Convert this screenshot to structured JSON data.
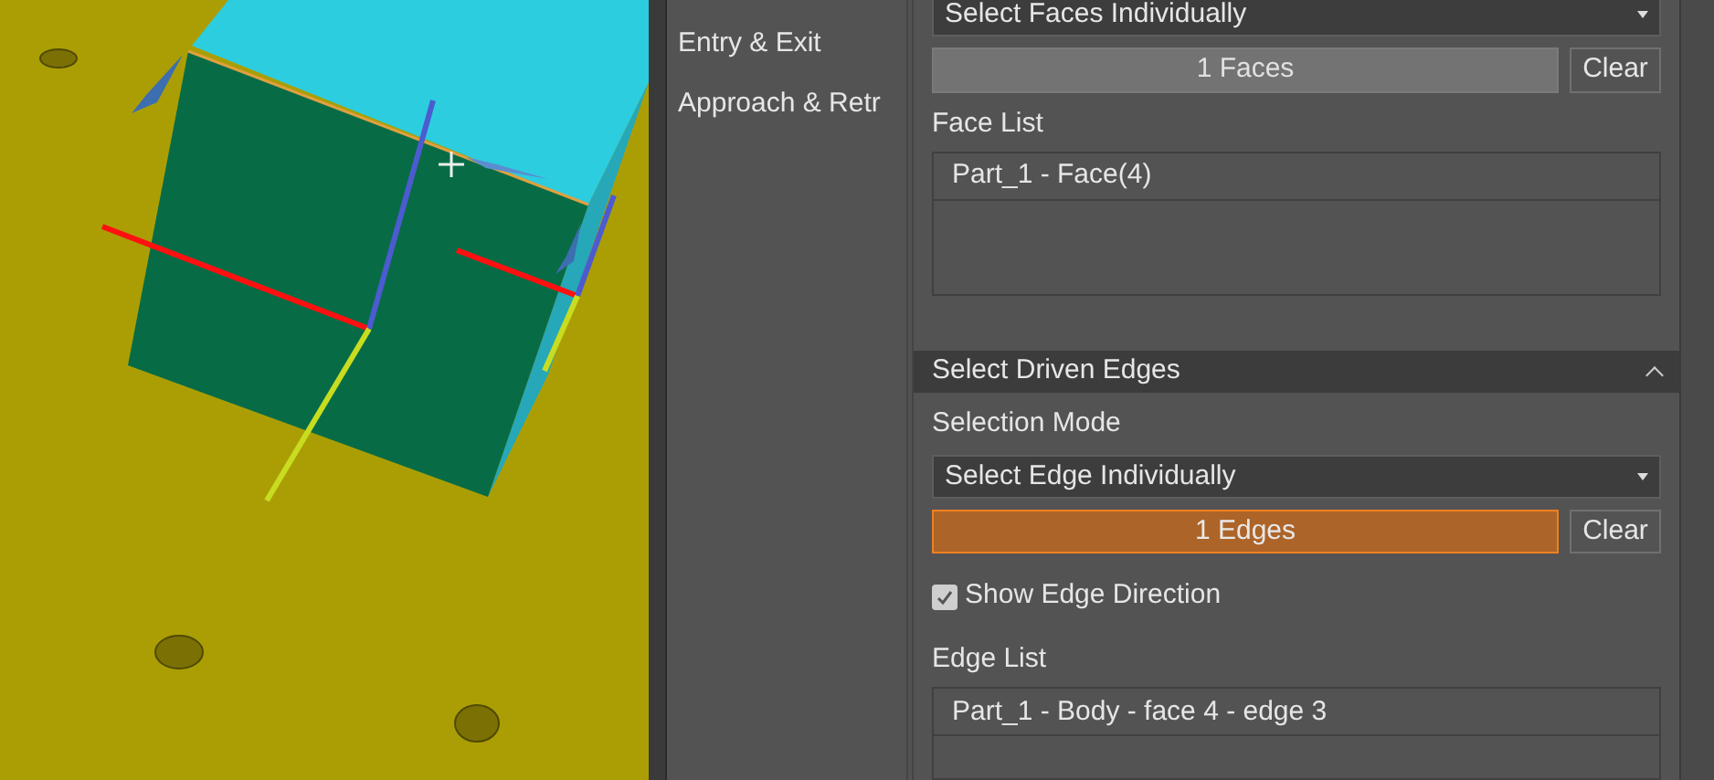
{
  "nav_items": [
    {
      "label": "Entry & Exit"
    },
    {
      "label": "Approach & Retr"
    }
  ],
  "face_selection": {
    "mode_dropdown": {
      "value": "Select Faces Individually"
    },
    "count_button": {
      "label": "1 Faces",
      "active": false
    },
    "clear_button": "Clear",
    "list_label": "Face List",
    "list_items": [
      "Part_1 - Face(4)"
    ]
  },
  "edge_section": {
    "title": "Select Driven Edges",
    "expanded": true,
    "mode_label": "Selection Mode",
    "mode_dropdown": {
      "value": "Select Edge Individually"
    },
    "count_button": {
      "label": "1 Edges",
      "active": true
    },
    "clear_button": "Clear",
    "show_direction": {
      "label": "Show Edge Direction",
      "checked": true
    },
    "list_label": "Edge List",
    "list_items": [
      "Part_1 - Body - face 4 - edge 3"
    ]
  }
}
